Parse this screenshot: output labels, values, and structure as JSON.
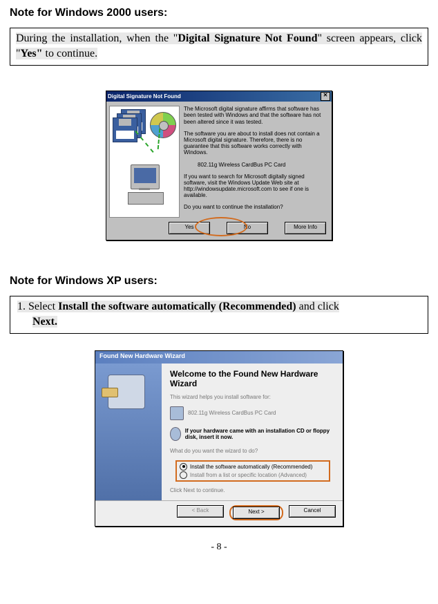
{
  "section1": {
    "heading": "Note for Windows 2000 users:",
    "note_pre": "During the installation, when the \"",
    "note_bold1": "Digital Signature Not Found",
    "note_mid1": "\" screen appears, click \"",
    "note_bold2": "Yes\"",
    "note_post": " to continue."
  },
  "dialog1": {
    "title": "Digital Signature Not Found",
    "p1": "The Microsoft digital signature affirms that software has been tested with Windows and that the software has not been altered since it was tested.",
    "p2": "The software you are about to install does not contain a Microsoft digital signature. Therefore, there is no guarantee that this software works correctly with Windows.",
    "device_name": "802.11g Wireless CardBus PC Card",
    "p3": "If you want to search for Microsoft digitally signed software, visit the Windows Update Web site at http://windowsupdate.microsoft.com to see if one is available.",
    "p4": "Do you want to continue the installation?",
    "btn_yes": "Yes",
    "btn_no": "No",
    "btn_more": "More Info"
  },
  "section2": {
    "heading": "Note for Windows XP users:",
    "note_pre": "1. Select ",
    "note_bold1": "Install the software automatically (Recommended)",
    "note_mid1": " and click ",
    "note_bold2": "Next."
  },
  "dialog2": {
    "title": "Found New Hardware Wizard",
    "welcome": "Welcome to the Found New Hardware Wizard",
    "intro": "This wizard helps you install software for:",
    "device": "802.11g Wireless CardBus PC Card",
    "cd_note": "If your hardware came with an installation CD or floppy disk, insert it now.",
    "prompt": "What do you want the wizard to do?",
    "opt1": "Install the software automatically (Recommended)",
    "opt2": "Install from a list or specific location (Advanced)",
    "click_next": "Click Next to continue.",
    "btn_back": "< Back",
    "btn_next": "Next >",
    "btn_cancel": "Cancel"
  },
  "page_number": "- 8 -"
}
